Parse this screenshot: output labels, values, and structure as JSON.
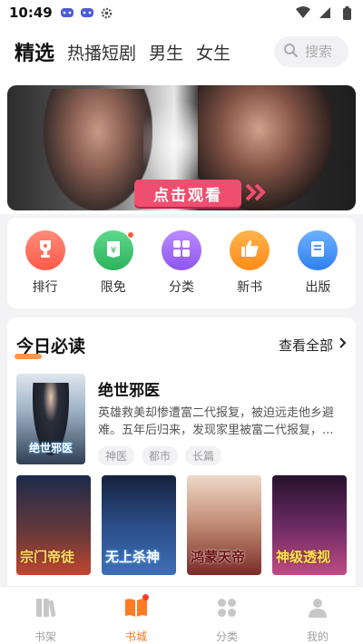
{
  "status_bar": {
    "time": "10:49",
    "icons_left": [
      "gamepad-icon",
      "gamepad-icon",
      "gear-icon"
    ],
    "icons_right": [
      "wifi-icon",
      "signal-icon",
      "battery-icon"
    ]
  },
  "top_nav": {
    "tabs": [
      {
        "label": "精选",
        "active": true
      },
      {
        "label": "热播短剧",
        "active": false
      },
      {
        "label": "男生",
        "active": false
      },
      {
        "label": "女生",
        "active": false
      }
    ],
    "search": {
      "placeholder": "搜索"
    }
  },
  "banner": {
    "cta_label": "点击观看"
  },
  "quick_entries": [
    {
      "label": "排行",
      "icon": "trophy-icon",
      "color": "#ff6a59",
      "dot": false
    },
    {
      "label": "限免",
      "icon": "price-tag-icon",
      "color": "#35c46b",
      "dot": true
    },
    {
      "label": "分类",
      "icon": "grid-icon",
      "color": "#a46bf5",
      "dot": false
    },
    {
      "label": "新书",
      "icon": "thumbs-up-icon",
      "color": "#ff9b2f",
      "dot": false
    },
    {
      "label": "出版",
      "icon": "book-icon",
      "color": "#3d8ff5",
      "dot": false
    }
  ],
  "today": {
    "title": "今日必读",
    "more_label": "查看全部",
    "feature": {
      "title": "绝世邪医",
      "cover_text": "绝世邪医",
      "description": "英雄救美却惨遭富二代报复，被迫远走他乡避难。五年后归来，发现家里被富二代报复，...",
      "tags": [
        "神医",
        "都市",
        "长篇"
      ]
    },
    "covers": [
      {
        "cover_text": "宗门帝徒",
        "below_title": "宗门帝徒",
        "colors": [
          "#1d2a4a",
          "#c3452f"
        ]
      },
      {
        "cover_text": "无上杀神",
        "below_title": "无上杀神",
        "colors": [
          "#14213d",
          "#3d6fb6"
        ]
      },
      {
        "cover_text": "鸿蒙天帝",
        "below_title": "鸿蒙天帝",
        "colors": [
          "#f0d8c8",
          "#7a2b28"
        ]
      },
      {
        "cover_text": "神级透视",
        "below_title": "神级透视",
        "colors": [
          "#26122e",
          "#c04b85"
        ]
      }
    ]
  },
  "bottom_nav": [
    {
      "label": "书架",
      "icon": "bookshelf-icon",
      "active": false
    },
    {
      "label": "书城",
      "icon": "open-book-icon",
      "active": true
    },
    {
      "label": "分类",
      "icon": "grid-icon",
      "active": false
    },
    {
      "label": "我的",
      "icon": "person-icon",
      "active": false
    }
  ],
  "colors": {
    "accent": "#ff7a22",
    "cta": "#f04e6f"
  }
}
